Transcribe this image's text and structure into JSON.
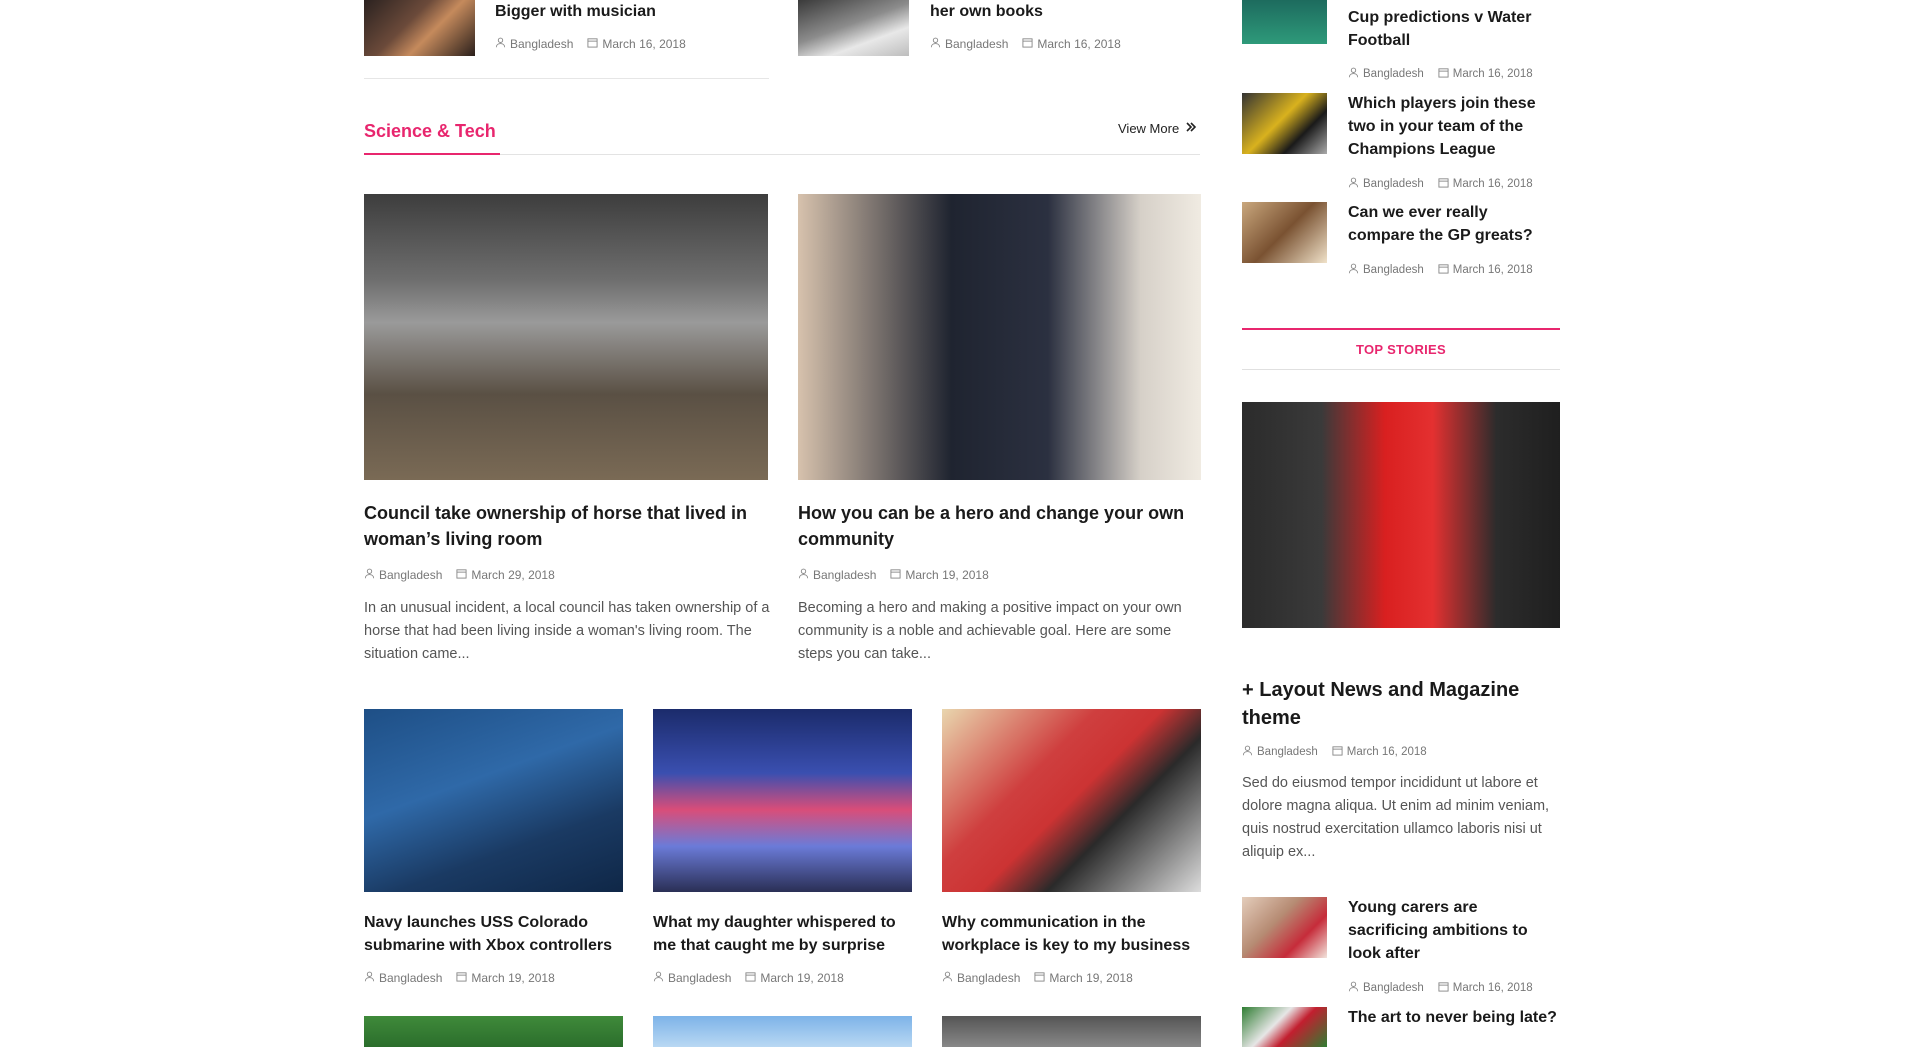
{
  "top_row": [
    {
      "title": "Bigger with musician",
      "author": "Bangladesh",
      "date": "March 16, 2018",
      "image_icon": "musician-image"
    },
    {
      "title": "her own books",
      "author": "Bangladesh",
      "date": "March 16, 2018",
      "image_icon": "books-image"
    }
  ],
  "section": {
    "title": "Science & Tech",
    "view_more": "View More",
    "accent_color": "#e8266e"
  },
  "featured": [
    {
      "title": "Council take ownership of horse that lived in woman’s living room",
      "author": "Bangladesh",
      "date": "March 29, 2018",
      "excerpt": "In an unusual incident, a local council has taken ownership of a horse that had been living inside a woman's living room. The situation came..."
    },
    {
      "title": "How you can be a hero and change your own community",
      "author": "Bangladesh",
      "date": "March 19, 2018",
      "excerpt": "Becoming a hero and making a positive impact on your own community is a noble and achievable goal. Here are some steps you can take..."
    }
  ],
  "grid": [
    {
      "title": "Navy launches USS Colorado submarine with Xbox controllers",
      "author": "Bangladesh",
      "date": "March 19, 2018"
    },
    {
      "title": "What my daughter whispered to me that caught me by surprise",
      "author": "Bangladesh",
      "date": "March 19, 2018"
    },
    {
      "title": "Why communication in the workplace is key to my business",
      "author": "Bangladesh",
      "date": "March 19, 2018"
    }
  ],
  "sidebar": {
    "list_top": [
      {
        "title": "Cup predictions v Water Football",
        "author": "Bangladesh",
        "date": "March 16, 2018"
      },
      {
        "title": "Which players join these two in your team of the Champions League",
        "author": "Bangladesh",
        "date": "March 16, 2018"
      },
      {
        "title": "Can we ever really compare the GP greats?",
        "author": "Bangladesh",
        "date": "March 16, 2018"
      }
    ],
    "top_stories_label": "TOP STORIES",
    "story": {
      "title": "+ Layout News and Magazine theme",
      "author": "Bangladesh",
      "date": "March 16, 2018",
      "excerpt": "Sed do eiusmod tempor incididunt ut labore et dolore magna aliqua. Ut enim ad minim veniam, quis nostrud exercitation ullamco laboris nisi ut aliquip ex..."
    },
    "list_bottom": [
      {
        "title": "Young carers are sacrificing ambitions to look after",
        "author": "Bangladesh",
        "date": "March 16, 2018"
      },
      {
        "title": "The art to never being late?",
        "author": "",
        "date": ""
      }
    ]
  }
}
